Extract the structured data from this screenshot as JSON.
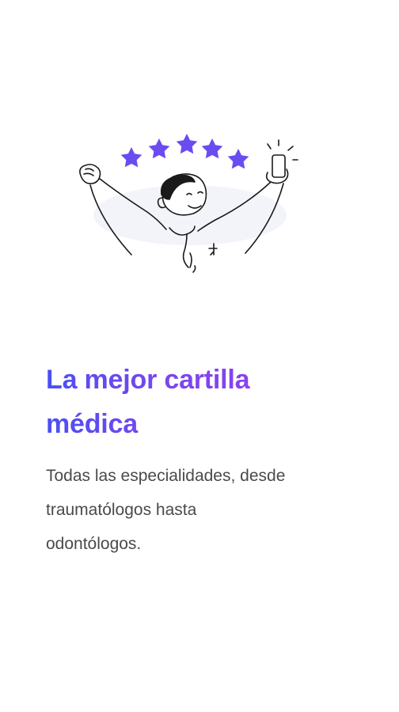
{
  "onboarding": {
    "title_line_1": "La mejor cartilla",
    "title_line_2": "médica",
    "description_lines": [
      "Todas las especialidades, desde",
      "traumatólogos hasta",
      "odontólogos."
    ],
    "illustration": "happy-person-with-five-stars",
    "colors": {
      "title_gradient_start": "#4b4ff2",
      "title_gradient_end": "#9a3ff0",
      "stars": "#6a4cf0",
      "body_text": "#4a4a4a",
      "background": "#ffffff"
    }
  }
}
